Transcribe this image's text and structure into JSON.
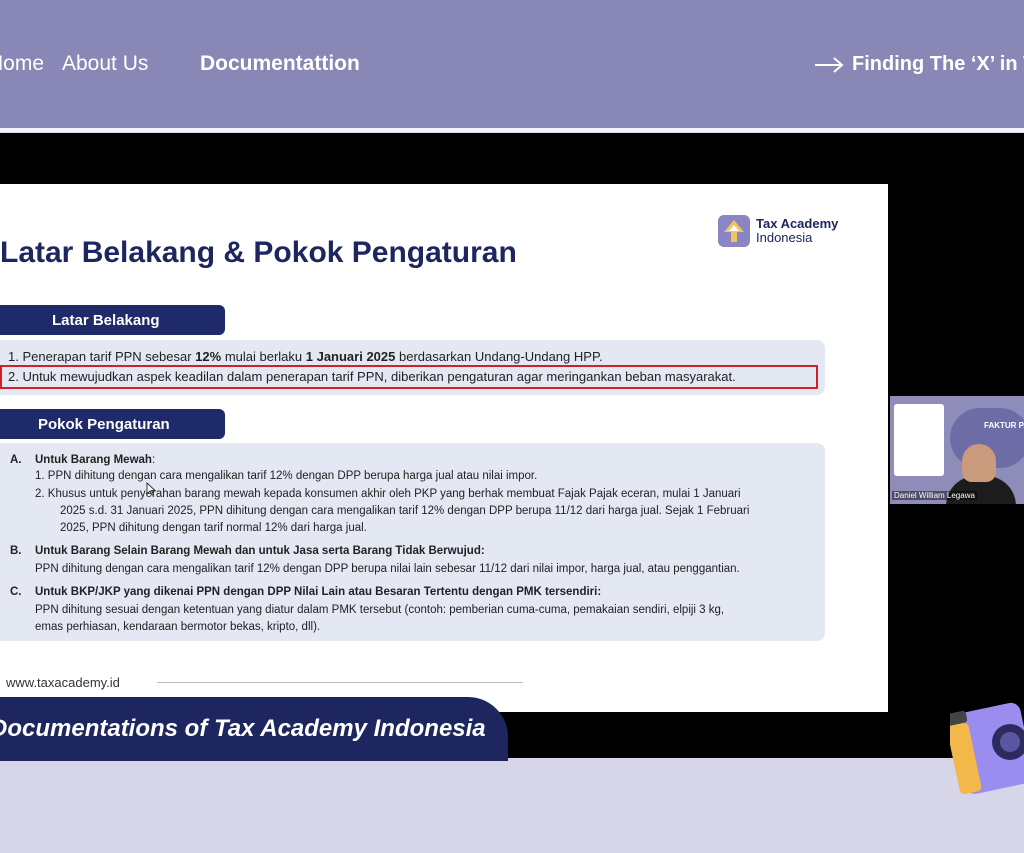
{
  "nav": {
    "home": "Home",
    "about": "About Us",
    "documentation": "Documentattion",
    "cta": "Finding The ‘X’ in Tax"
  },
  "slide": {
    "title": "Latar Belakang & Pokok Pengaturan",
    "logo_line1": "Tax Academy",
    "logo_line2": "Indonesia",
    "section1": "Latar Belakang",
    "item1_pre": "1.   Penerapan tarif PPN sebesar ",
    "item1_b1": "12%",
    "item1_mid": " mulai berlaku ",
    "item1_b2": "1 Januari 2025",
    "item1_post": " berdasarkan Undang-Undang HPP.",
    "item2": "2.   Untuk mewujudkan aspek keadilan dalam penerapan tarif PPN, diberikan pengaturan agar meringankan beban masyarakat.",
    "section2": "Pokok Pengaturan",
    "a_label": "A.",
    "a_title": "Untuk Barang Mewah",
    "a_colon": ":",
    "a1": "1.   PPN dihitung dengan cara mengalikan tarif 12% dengan DPP berupa harga jual atau nilai impor.",
    "a2_l1": "2.   Khusus untuk penyerahan barang mewah kepada konsumen akhir oleh PKP yang berhak membuat Fajak Pajak eceran, mulai 1 Januari",
    "a2_l2": "2025 s.d. 31 Januari 2025, PPN dihitung dengan cara mengalikan tarif 12% dengan DPP berupa 11/12 dari harga jual. Sejak 1 Februari",
    "a2_l3": "2025, PPN dihitung dengan tarif normal 12% dari  harga jual.",
    "b_label": "B.",
    "b_title": "Untuk Barang Selain Barang Mewah dan untuk Jasa serta Barang Tidak Berwujud:",
    "b_text": "PPN dihitung dengan cara mengalikan tarif 12% dengan DPP berupa nilai lain sebesar 11/12 dari nilai impor, harga jual, atau penggantian.",
    "c_label": "C.",
    "c_title": "Untuk BKP/JKP yang dikenai PPN dengan DPP Nilai Lain atau Besaran Tertentu dengan PMK tersendiri:",
    "c_l1": "PPN dihitung sesuai dengan ketentuan yang diatur dalam PMK tersebut (contoh: pemberian cuma-cuma, pemakaian sendiri, elpiji 3 kg,",
    "c_l2": "emas perhiasan, kendaraan bermotor bekas, kripto, dll).",
    "website": "www.taxacademy.id"
  },
  "webcam": {
    "slide_title": "FAKTUR PAJAK",
    "participant": "Daniel William Legawa"
  },
  "banner": "Documentations of Tax Academy Indonesia",
  "colors": {
    "nav_bg": "#8887b5",
    "navy": "#1e2660",
    "highlight": "#d0202a"
  }
}
